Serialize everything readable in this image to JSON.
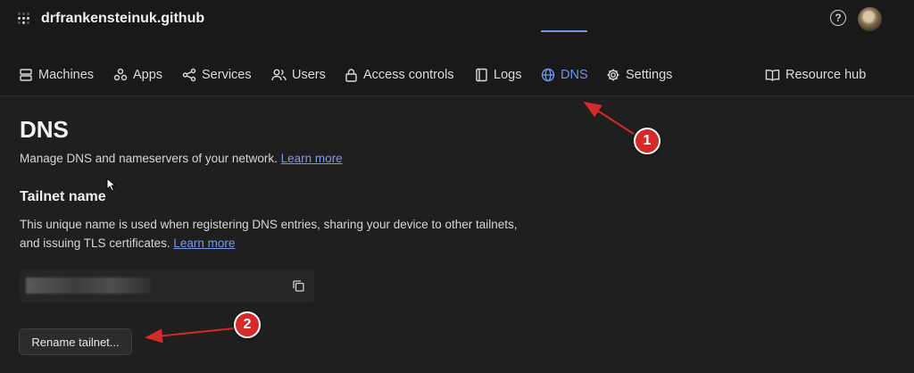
{
  "header": {
    "org_name": "drfrankensteinuk.github",
    "help_icon": "help-circle-icon",
    "avatar": "user-avatar"
  },
  "nav": {
    "items": [
      {
        "label": "Machines",
        "icon": "machines-icon"
      },
      {
        "label": "Apps",
        "icon": "apps-icon"
      },
      {
        "label": "Services",
        "icon": "services-icon"
      },
      {
        "label": "Users",
        "icon": "users-icon"
      },
      {
        "label": "Access controls",
        "icon": "lock-icon"
      },
      {
        "label": "Logs",
        "icon": "logs-icon"
      },
      {
        "label": "DNS",
        "icon": "globe-icon",
        "active": true
      },
      {
        "label": "Settings",
        "icon": "gear-icon"
      },
      {
        "label": "Resource hub",
        "icon": "book-icon"
      }
    ],
    "active_color": "#6f94e8"
  },
  "page": {
    "title": "DNS",
    "description": "Manage DNS and nameservers of your network.",
    "learn_more": "Learn more"
  },
  "tailnet": {
    "title": "Tailnet name",
    "description": "This unique name is used when registering DNS entries, sharing your device to other tailnets, and issuing TLS certificates.",
    "learn_more": "Learn more",
    "copy_icon": "copy-icon",
    "rename_button": "Rename tailnet..."
  },
  "annotations": {
    "badge_1": "1",
    "badge_2": "2",
    "color": "#d42a2a"
  }
}
